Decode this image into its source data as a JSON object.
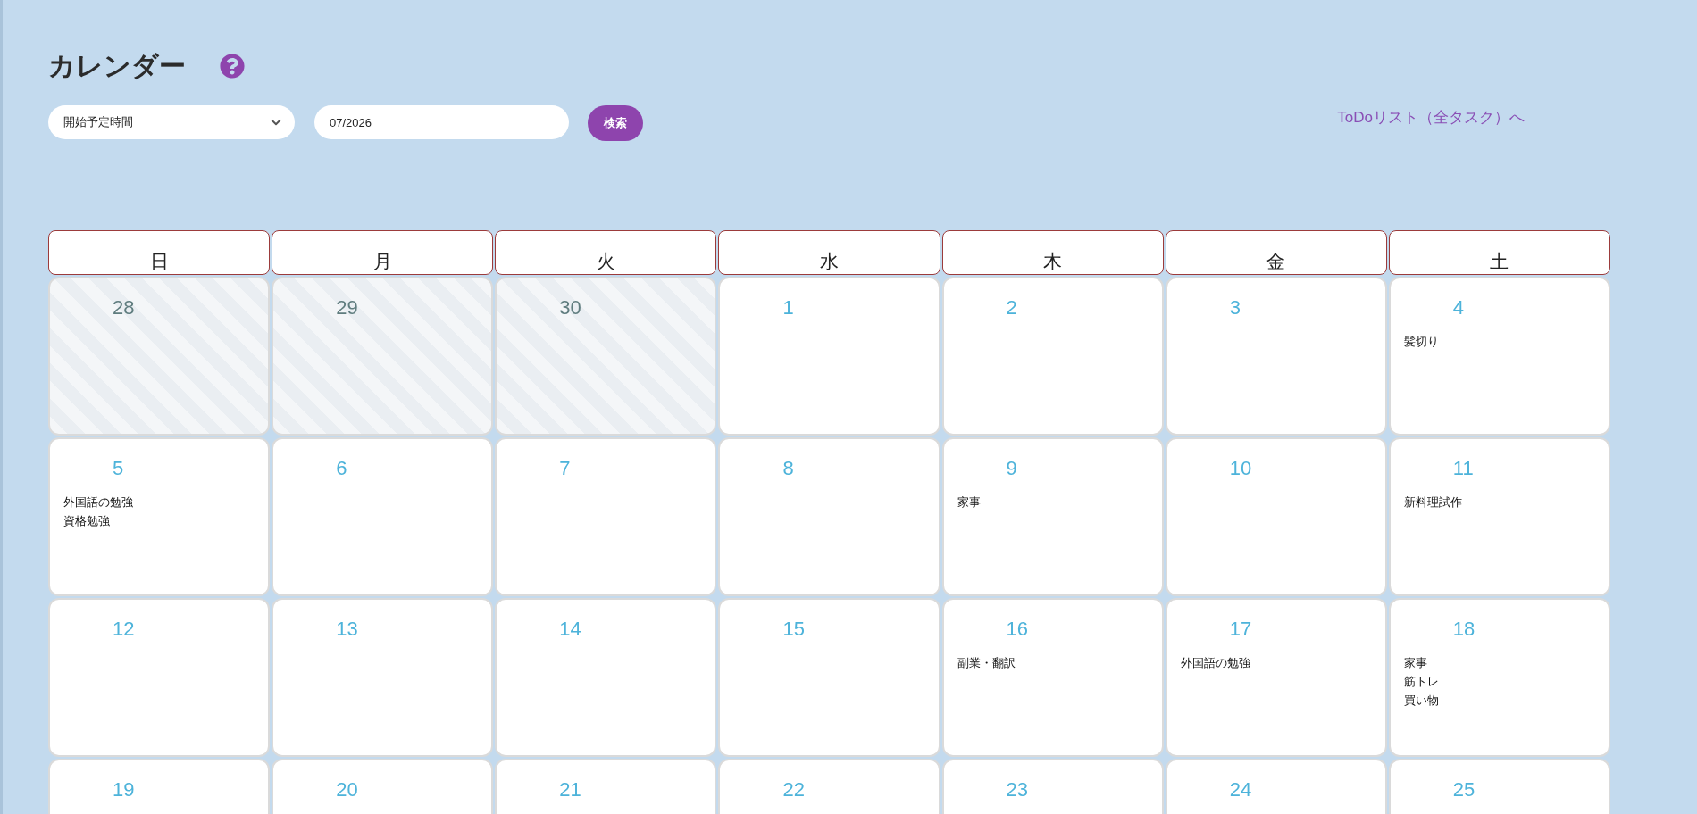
{
  "page": {
    "title": "カレンダー"
  },
  "filters": {
    "sort_select": {
      "value": "開始予定時間"
    },
    "month_field": {
      "value": "07/2026"
    },
    "search_button": {
      "label": "検索"
    }
  },
  "todo_link": {
    "label": "ToDoリスト（全タスク）へ"
  },
  "calendar": {
    "weekdays": [
      "日",
      "月",
      "火",
      "水",
      "木",
      "金",
      "土"
    ],
    "weeks": [
      [
        {
          "day": "28",
          "in_month": false
        },
        {
          "day": "29",
          "in_month": false
        },
        {
          "day": "30",
          "in_month": false
        },
        {
          "day": "1",
          "in_month": true
        },
        {
          "day": "2",
          "in_month": true
        },
        {
          "day": "3",
          "in_month": true
        },
        {
          "day": "4",
          "in_month": true,
          "events": [
            "髪切り"
          ]
        }
      ],
      [
        {
          "day": "5",
          "in_month": true,
          "events": [
            "外国語の勉強",
            "資格勉強"
          ]
        },
        {
          "day": "6",
          "in_month": true
        },
        {
          "day": "7",
          "in_month": true
        },
        {
          "day": "8",
          "in_month": true
        },
        {
          "day": "9",
          "in_month": true,
          "events": [
            "家事"
          ]
        },
        {
          "day": "10",
          "in_month": true
        },
        {
          "day": "11",
          "in_month": true,
          "events": [
            "新料理試作"
          ]
        }
      ],
      [
        {
          "day": "12",
          "in_month": true
        },
        {
          "day": "13",
          "in_month": true
        },
        {
          "day": "14",
          "in_month": true
        },
        {
          "day": "15",
          "in_month": true
        },
        {
          "day": "16",
          "in_month": true,
          "events": [
            "副業・翻訳"
          ]
        },
        {
          "day": "17",
          "in_month": true,
          "events": [
            "外国語の勉強"
          ]
        },
        {
          "day": "18",
          "in_month": true,
          "events": [
            "家事",
            "筋トレ",
            "買い物"
          ]
        }
      ],
      [
        {
          "day": "19",
          "in_month": true
        },
        {
          "day": "20",
          "in_month": true
        },
        {
          "day": "21",
          "in_month": true
        },
        {
          "day": "22",
          "in_month": true
        },
        {
          "day": "23",
          "in_month": true
        },
        {
          "day": "24",
          "in_month": true
        },
        {
          "day": "25",
          "in_month": true
        }
      ]
    ]
  }
}
